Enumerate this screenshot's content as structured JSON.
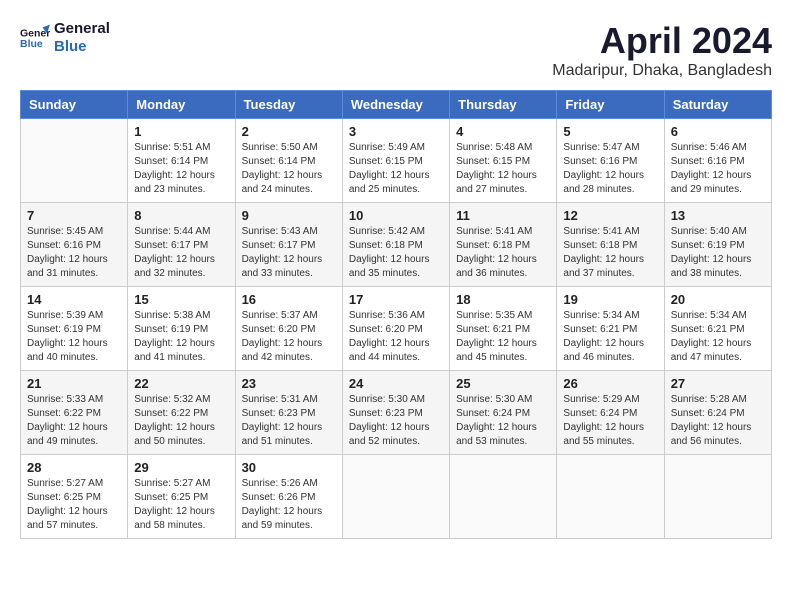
{
  "logo": {
    "line1": "General",
    "line2": "Blue"
  },
  "title": "April 2024",
  "subtitle": "Madaripur, Dhaka, Bangladesh",
  "headers": [
    "Sunday",
    "Monday",
    "Tuesday",
    "Wednesday",
    "Thursday",
    "Friday",
    "Saturday"
  ],
  "weeks": [
    [
      {
        "day": "",
        "info": ""
      },
      {
        "day": "1",
        "info": "Sunrise: 5:51 AM\nSunset: 6:14 PM\nDaylight: 12 hours\nand 23 minutes."
      },
      {
        "day": "2",
        "info": "Sunrise: 5:50 AM\nSunset: 6:14 PM\nDaylight: 12 hours\nand 24 minutes."
      },
      {
        "day": "3",
        "info": "Sunrise: 5:49 AM\nSunset: 6:15 PM\nDaylight: 12 hours\nand 25 minutes."
      },
      {
        "day": "4",
        "info": "Sunrise: 5:48 AM\nSunset: 6:15 PM\nDaylight: 12 hours\nand 27 minutes."
      },
      {
        "day": "5",
        "info": "Sunrise: 5:47 AM\nSunset: 6:16 PM\nDaylight: 12 hours\nand 28 minutes."
      },
      {
        "day": "6",
        "info": "Sunrise: 5:46 AM\nSunset: 6:16 PM\nDaylight: 12 hours\nand 29 minutes."
      }
    ],
    [
      {
        "day": "7",
        "info": "Sunrise: 5:45 AM\nSunset: 6:16 PM\nDaylight: 12 hours\nand 31 minutes."
      },
      {
        "day": "8",
        "info": "Sunrise: 5:44 AM\nSunset: 6:17 PM\nDaylight: 12 hours\nand 32 minutes."
      },
      {
        "day": "9",
        "info": "Sunrise: 5:43 AM\nSunset: 6:17 PM\nDaylight: 12 hours\nand 33 minutes."
      },
      {
        "day": "10",
        "info": "Sunrise: 5:42 AM\nSunset: 6:18 PM\nDaylight: 12 hours\nand 35 minutes."
      },
      {
        "day": "11",
        "info": "Sunrise: 5:41 AM\nSunset: 6:18 PM\nDaylight: 12 hours\nand 36 minutes."
      },
      {
        "day": "12",
        "info": "Sunrise: 5:41 AM\nSunset: 6:18 PM\nDaylight: 12 hours\nand 37 minutes."
      },
      {
        "day": "13",
        "info": "Sunrise: 5:40 AM\nSunset: 6:19 PM\nDaylight: 12 hours\nand 38 minutes."
      }
    ],
    [
      {
        "day": "14",
        "info": "Sunrise: 5:39 AM\nSunset: 6:19 PM\nDaylight: 12 hours\nand 40 minutes."
      },
      {
        "day": "15",
        "info": "Sunrise: 5:38 AM\nSunset: 6:19 PM\nDaylight: 12 hours\nand 41 minutes."
      },
      {
        "day": "16",
        "info": "Sunrise: 5:37 AM\nSunset: 6:20 PM\nDaylight: 12 hours\nand 42 minutes."
      },
      {
        "day": "17",
        "info": "Sunrise: 5:36 AM\nSunset: 6:20 PM\nDaylight: 12 hours\nand 44 minutes."
      },
      {
        "day": "18",
        "info": "Sunrise: 5:35 AM\nSunset: 6:21 PM\nDaylight: 12 hours\nand 45 minutes."
      },
      {
        "day": "19",
        "info": "Sunrise: 5:34 AM\nSunset: 6:21 PM\nDaylight: 12 hours\nand 46 minutes."
      },
      {
        "day": "20",
        "info": "Sunrise: 5:34 AM\nSunset: 6:21 PM\nDaylight: 12 hours\nand 47 minutes."
      }
    ],
    [
      {
        "day": "21",
        "info": "Sunrise: 5:33 AM\nSunset: 6:22 PM\nDaylight: 12 hours\nand 49 minutes."
      },
      {
        "day": "22",
        "info": "Sunrise: 5:32 AM\nSunset: 6:22 PM\nDaylight: 12 hours\nand 50 minutes."
      },
      {
        "day": "23",
        "info": "Sunrise: 5:31 AM\nSunset: 6:23 PM\nDaylight: 12 hours\nand 51 minutes."
      },
      {
        "day": "24",
        "info": "Sunrise: 5:30 AM\nSunset: 6:23 PM\nDaylight: 12 hours\nand 52 minutes."
      },
      {
        "day": "25",
        "info": "Sunrise: 5:30 AM\nSunset: 6:24 PM\nDaylight: 12 hours\nand 53 minutes."
      },
      {
        "day": "26",
        "info": "Sunrise: 5:29 AM\nSunset: 6:24 PM\nDaylight: 12 hours\nand 55 minutes."
      },
      {
        "day": "27",
        "info": "Sunrise: 5:28 AM\nSunset: 6:24 PM\nDaylight: 12 hours\nand 56 minutes."
      }
    ],
    [
      {
        "day": "28",
        "info": "Sunrise: 5:27 AM\nSunset: 6:25 PM\nDaylight: 12 hours\nand 57 minutes."
      },
      {
        "day": "29",
        "info": "Sunrise: 5:27 AM\nSunset: 6:25 PM\nDaylight: 12 hours\nand 58 minutes."
      },
      {
        "day": "30",
        "info": "Sunrise: 5:26 AM\nSunset: 6:26 PM\nDaylight: 12 hours\nand 59 minutes."
      },
      {
        "day": "",
        "info": ""
      },
      {
        "day": "",
        "info": ""
      },
      {
        "day": "",
        "info": ""
      },
      {
        "day": "",
        "info": ""
      }
    ]
  ]
}
